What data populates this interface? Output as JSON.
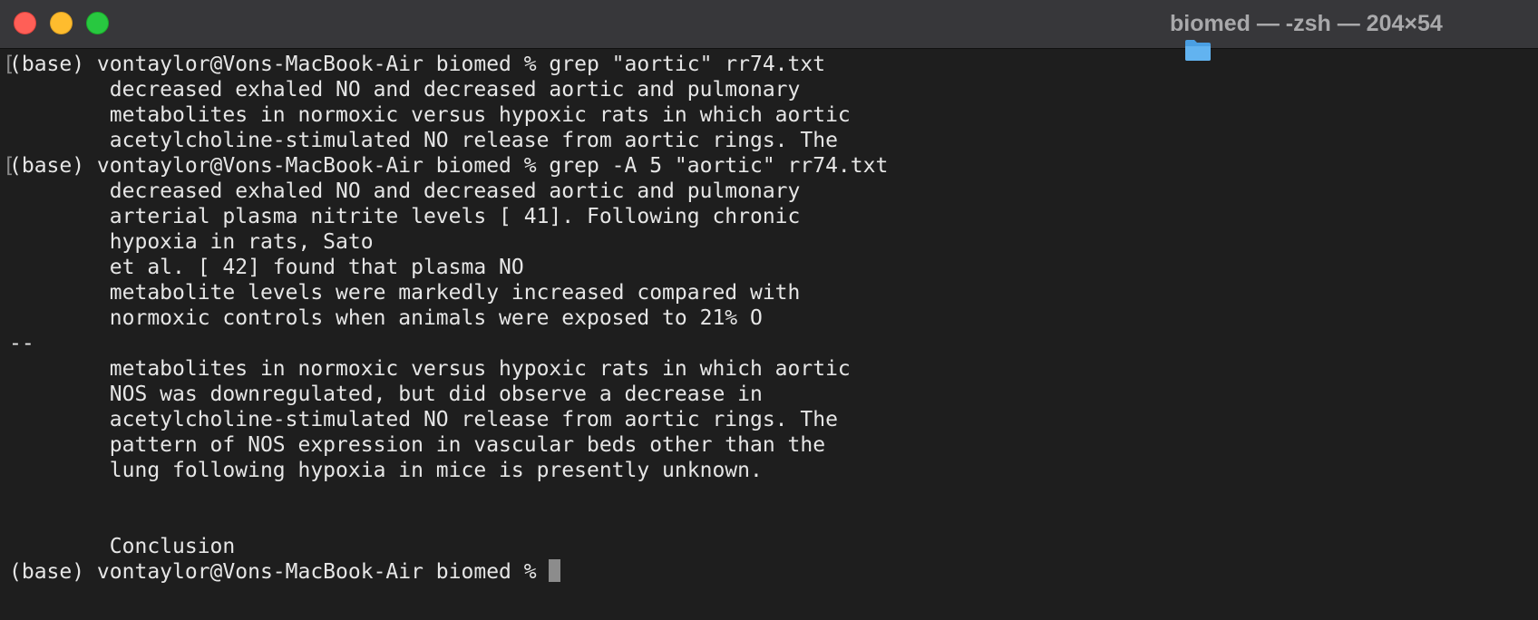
{
  "window": {
    "title": "biomed — -zsh — 204×54",
    "colors": {
      "close": "#ff5f57",
      "minimize": "#febc2e",
      "maximize": "#28c840",
      "background": "#1e1e1e",
      "text": "#e6e6e6",
      "titlebar": "#37373a"
    }
  },
  "terminal": {
    "prompt_mark": "[",
    "lines": {
      "l0": "(base) vontaylor@Vons-MacBook-Air biomed % grep \"aortic\" rr74.txt",
      "l1": "        decreased exhaled NO and decreased aortic and pulmonary",
      "l2": "        metabolites in normoxic versus hypoxic rats in which aortic",
      "l3": "        acetylcholine-stimulated NO release from aortic rings. The",
      "l4": "(base) vontaylor@Vons-MacBook-Air biomed % grep -A 5 \"aortic\" rr74.txt",
      "l5": "        decreased exhaled NO and decreased aortic and pulmonary",
      "l6": "        arterial plasma nitrite levels [ 41]. Following chronic",
      "l7": "        hypoxia in rats, Sato",
      "l8": "        et al. [ 42] found that plasma NO",
      "l9": "        metabolite levels were markedly increased compared with",
      "l10": "        normoxic controls when animals were exposed to 21% O",
      "l11": "--",
      "l12": "        metabolites in normoxic versus hypoxic rats in which aortic",
      "l13": "        NOS was downregulated, but did observe a decrease in",
      "l14": "        acetylcholine-stimulated NO release from aortic rings. The",
      "l15": "        pattern of NOS expression in vascular beds other than the",
      "l16": "        lung following hypoxia in mice is presently unknown.",
      "l17": "",
      "l18": "",
      "l19": "        Conclusion",
      "l20": "(base) vontaylor@Vons-MacBook-Air biomed % "
    }
  }
}
